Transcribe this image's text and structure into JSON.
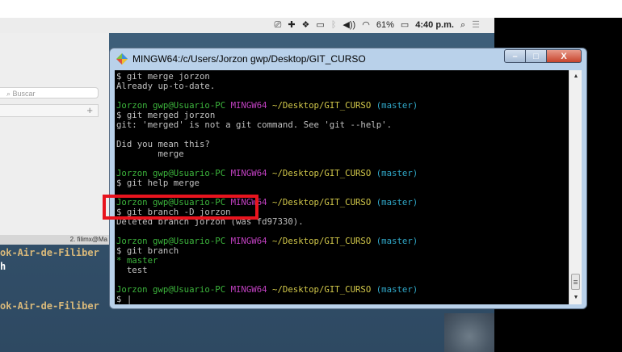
{
  "menubar": {
    "battery": "61%",
    "time": "4:40 p.m."
  },
  "finder": {
    "search_placeholder": "Buscar",
    "add_symbol": "+"
  },
  "background_terminal": {
    "tab_label": "2. filimx@Ma",
    "line1": "ok-Air-de-Filiber",
    "line2": "h",
    "line3": "ok-Air-de-Filiber"
  },
  "window": {
    "title": "MINGW64:/c/Users/Jorzon gwp/Desktop/GIT_CURSO",
    "controls": {
      "minimize": "–",
      "maximize": "□",
      "close": "X"
    }
  },
  "terminal": {
    "prompt_user": "Jorzon gwp@Usuario-PC",
    "prompt_env": "MINGW64",
    "prompt_path": "~/Desktop/GIT_CURSO",
    "prompt_branch": "(master)",
    "cmd1": "$ git merge jorzon",
    "out1": "Already up-to-date.",
    "cmd2": "$ git merged jorzon",
    "out2a": "git: 'merged' is not a git command. See 'git --help'.",
    "out2b": "Did you mean this?",
    "out2c": "        merge",
    "cmd3": "$ git help merge",
    "cmd4": "$ git branch -D jorzon",
    "out4": "Deleted branch jorzon (was fd97330).",
    "cmd5": "$ git branch",
    "branch_current": "* master",
    "branch_other": "  test",
    "final_prompt": "$ |"
  },
  "colors": {
    "prompt_green": "#3cb43c",
    "prompt_magenta": "#c040c0",
    "prompt_yellow": "#d2c84a",
    "prompt_cyan": "#30a8c8",
    "highlight_red": "#e8141e"
  }
}
